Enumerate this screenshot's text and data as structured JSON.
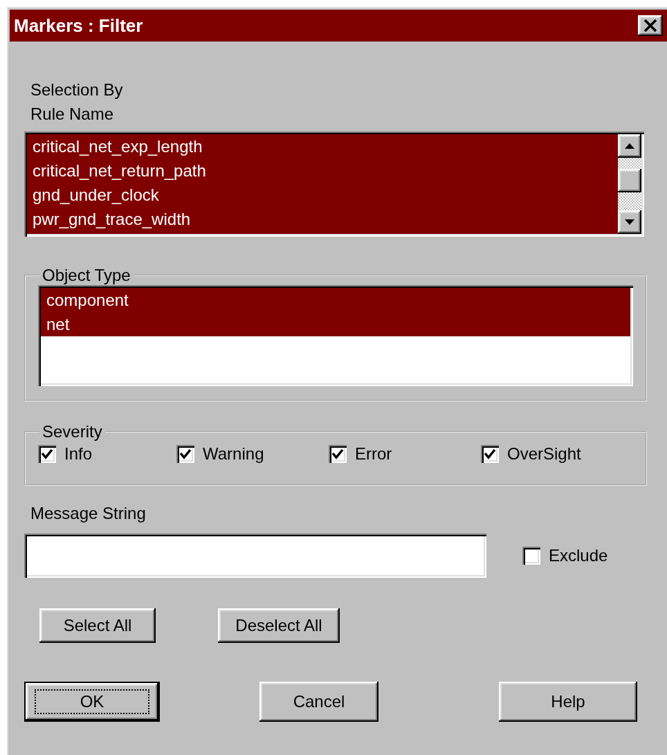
{
  "window": {
    "title": "Markers : Filter"
  },
  "rule_name": {
    "label_lines": [
      "Selection By",
      "Rule Name"
    ],
    "items": [
      {
        "label": "critical_net_exp_length",
        "selected": true
      },
      {
        "label": "critical_net_return_path",
        "selected": true
      },
      {
        "label": "gnd_under_clock",
        "selected": true
      },
      {
        "label": "pwr_gnd_trace_width",
        "selected": true
      }
    ]
  },
  "object_type": {
    "legend": "Object Type",
    "items": [
      {
        "label": "component",
        "selected": true
      },
      {
        "label": "net",
        "selected": true
      }
    ]
  },
  "severity": {
    "legend": "Severity",
    "options": [
      {
        "label": "Info",
        "checked": true
      },
      {
        "label": "Warning",
        "checked": true
      },
      {
        "label": "Error",
        "checked": true
      },
      {
        "label": "OverSight",
        "checked": true
      }
    ]
  },
  "message": {
    "label": "Message String"
  },
  "exclude": {
    "label": "Exclude",
    "checked": false
  },
  "select_buttons": [
    {
      "label": "Select All"
    },
    {
      "label": "Deselect All"
    }
  ],
  "dialog_buttons": [
    {
      "label": "OK",
      "default": true
    },
    {
      "label": "Cancel",
      "default": false
    },
    {
      "label": "Help",
      "default": false
    }
  ]
}
